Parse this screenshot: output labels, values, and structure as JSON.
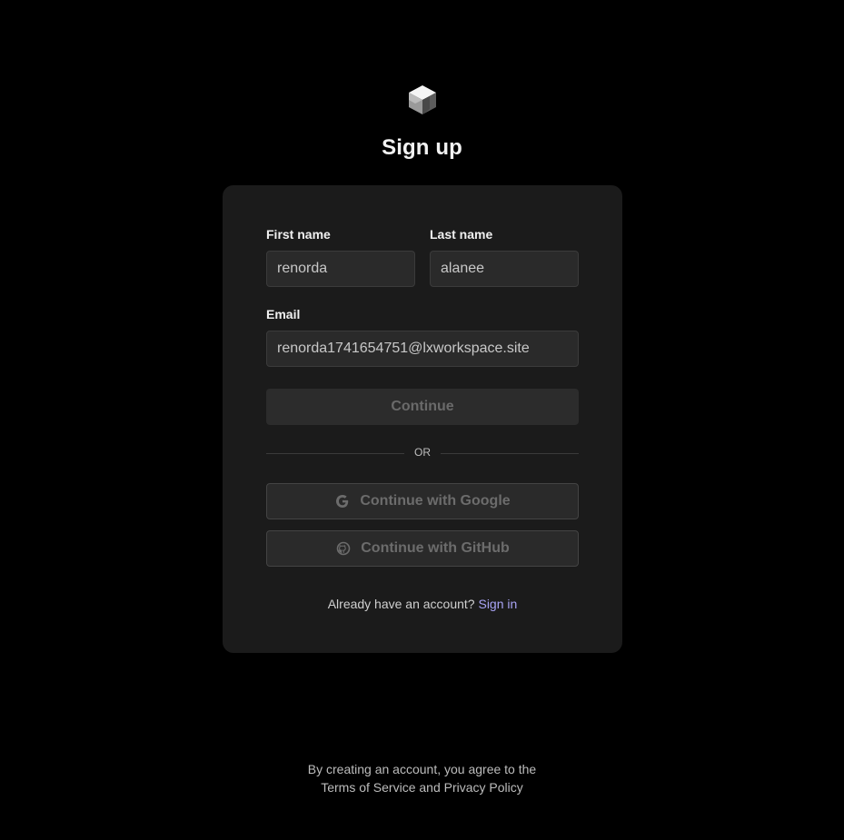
{
  "header": {
    "logo_icon": "cube-logo-icon",
    "title": "Sign up"
  },
  "form": {
    "first_name_label": "First name",
    "first_name_value": "renorda",
    "last_name_label": "Last name",
    "last_name_value": "alanee",
    "email_label": "Email",
    "email_value": "renorda1741654751@lxworkspace.site",
    "continue_label": "Continue",
    "divider_text": "OR",
    "google_label": "Continue with Google",
    "google_icon": "google-icon",
    "github_label": "Continue with GitHub",
    "github_icon": "github-icon",
    "signin_prompt": "Already have an account?",
    "signin_link": "Sign in"
  },
  "footer": {
    "line1": "By creating an account, you agree to the",
    "terms_link": "Terms of Service",
    "and_text": "and",
    "privacy_link": "Privacy Policy"
  },
  "colors": {
    "background": "#000000",
    "card": "#1b1b1b",
    "input": "#2a2a2a",
    "link_accent": "#a9a4f5"
  }
}
